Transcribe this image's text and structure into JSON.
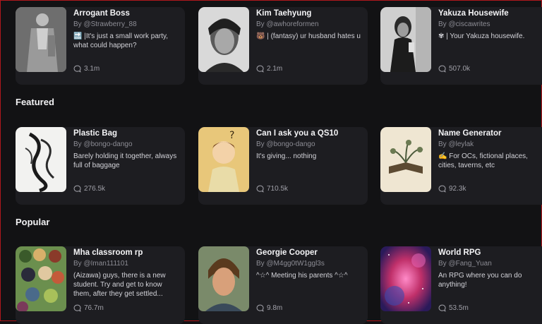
{
  "sections": {
    "featured": "Featured",
    "popular": "Popular"
  },
  "rows": [
    [
      {
        "title": "Arrogant Boss",
        "author": "By @Strawberry_88",
        "desc": "🔜 |It's just a small work party, what could happen?",
        "count": "3.1m",
        "image": "man-in-suit"
      },
      {
        "title": "Kim Taehyung",
        "author": "By @awhoreformen",
        "desc": "🐻 | (fantasy) ur husband hates u",
        "count": "2.1m",
        "image": "portrait-bw"
      },
      {
        "title": "Yakuza Housewife",
        "author": "By @ciscawrites",
        "desc": "✾ | Your Yakuza housewife.",
        "count": "507.0k",
        "image": "bw-figure"
      }
    ],
    [
      {
        "title": "Plastic Bag",
        "author": "By @bongo-dango",
        "desc": "Barely holding it together, always full of baggage",
        "count": "276.5k",
        "image": "ink-sketch"
      },
      {
        "title": "Can I ask you a QS10",
        "author": "By @bongo-dango",
        "desc": "It's giving... nothing",
        "count": "710.5k",
        "image": "cartoon-boy"
      },
      {
        "title": "Name Generator",
        "author": "By @leylak",
        "desc": "✍ For OCs, fictional places, cities, taverns, etc",
        "count": "92.3k",
        "image": "book-illustration"
      }
    ],
    [
      {
        "title": "Mha classroom rp",
        "author": "By @Iman111101",
        "desc": "(Aizawa) guys, there is a new student. Try and get to know them, after they get settled...",
        "count": "76.7m",
        "image": "anime-group"
      },
      {
        "title": "Georgie Cooper",
        "author": "By @M4gg0tW1ggl3s",
        "desc": "^☆^ Meeting his parents ^☆^",
        "count": "9.8m",
        "image": "young-man"
      },
      {
        "title": "World RPG",
        "author": "By @Fang_Yuan",
        "desc": "An RPG where you can do anything!",
        "count": "53.5m",
        "image": "nebula"
      }
    ]
  ],
  "icons": {
    "stat": "chat-bubble-icon"
  },
  "colors": {
    "background": "#121214",
    "card": "#1d1d21",
    "border": "#b0181c"
  }
}
